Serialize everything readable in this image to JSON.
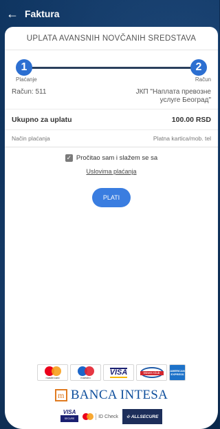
{
  "appbar": {
    "back_icon": "arrow-left-icon",
    "title": "Faktura"
  },
  "page": {
    "heading": "UPLATA AVANSNIH NOVČANIH SREDSTAVA"
  },
  "stepper": {
    "steps": [
      {
        "number": "1",
        "label": "Plaćanje"
      },
      {
        "number": "2",
        "label": "Račun"
      }
    ]
  },
  "invoice": {
    "racun_label": "Račun: 511",
    "racun_value_line1": "ЈКП \"Наплата превозне",
    "racun_value_line2": "услуге Београд\"",
    "total_label": "Ukupno za uplatu",
    "total_value": "100.00 RSD",
    "method_label": "Način plaćanja",
    "method_value": "Platna kartica/mob. tel"
  },
  "terms": {
    "checked": true,
    "check_icon": "checkmark-icon",
    "text": "Pročitao sam i slažem se sa",
    "link": "Uslovima plaćanja"
  },
  "actions": {
    "pay_label": "PLATI"
  },
  "logos": {
    "mastercard_sub": "mastercard",
    "maestro_sub": "maestro",
    "visa": "VISA",
    "diners": "Diners Club",
    "amex_line1": "AMERICAN",
    "amex_line2": "EXPRESS",
    "intesa_mark": "m",
    "intesa_name": "BANCA INTESA",
    "visa_secure_top": "VISA",
    "visa_secure_bottom": "SECURE",
    "idcheck": "ID Check",
    "allsecure": "☆ ALLSECURE"
  },
  "colors": {
    "accent": "#3a7de0",
    "stepper": "#2c6fd1",
    "background": "#0d2c52"
  }
}
